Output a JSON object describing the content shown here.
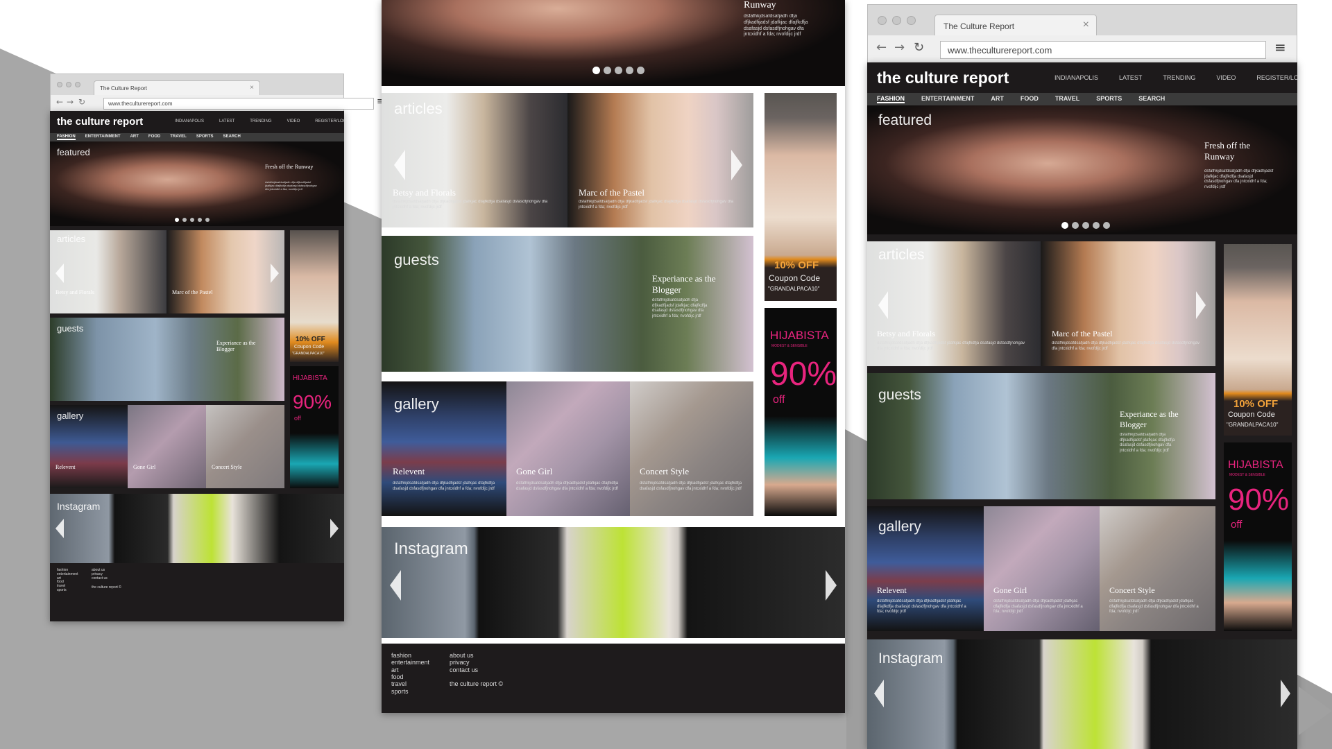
{
  "browser": {
    "tab_title": "The Culture Report",
    "tab_close": "×",
    "url": "www.theculturereport.com",
    "back": "←",
    "forward": "→",
    "reload": "↻",
    "menu": "≡"
  },
  "site": {
    "brand": "the culture report",
    "top_nav": [
      "INDIANAPOLIS",
      "LATEST",
      "TRENDING",
      "VIDEO",
      "REGISTER/LOGIN"
    ],
    "categories": [
      "FASHION",
      "ENTERTAINMENT",
      "ART",
      "FOOD",
      "TRAVEL",
      "SPORTS",
      "SEARCH"
    ]
  },
  "featured": {
    "label": "featured",
    "caption_title": "Fresh off the Runway",
    "caption_title_short": "Runway",
    "caption_body": "dsfafhkjdsafdsafjadh dfja dfjkadfijadsf jdafkjac dfajfkdfja dsafasjd dsfasdfjnohgav dfa jntcxidhf a fda; nvofdijc jrdf"
  },
  "articles": {
    "label": "articles",
    "items": [
      {
        "title": "Betsy and Florals",
        "body": "dsfafhkjdsafdsafjadh dfja dfjkadfijadsf jdafkjac dfajfkdfja dsafasjd dsfasdfjnohgav dfa jntcxidhf a fda; nvofdijc jrdf"
      },
      {
        "title": "Marc of the Pastel",
        "body": "dsfafhkjdsafdsafjadh dfja dfjkadfijadsf jdafkjac dfajfkdfja dsafasjd dsfasdfjnohgav dfa jntcxidhf a fda; nvofdijc jrdf"
      }
    ]
  },
  "guests": {
    "label": "guests",
    "title": "Experiance as the Blogger",
    "body": "dsfafhkjdsafdsafjadh dfja dfjkadfijadsf jdafkjac dfajfkdfja dsafasjd dsfasdfjnohgav dfa jntcxidhf a fda; nvofdijc jrdf"
  },
  "gallery": {
    "label": "gallery",
    "items": [
      {
        "title": "Relevent",
        "body": "dsfafhkjdsafdsafjadh dfja dfjkadfijadsf jdafkjac dfajfkdfja dsafasjd dsfasdfjnohgav dfa jntcxidhf a fda; nvofdijc jrdf"
      },
      {
        "title": "Gone Girl",
        "body": "dsfafhkjdsafdsafjadh dfja dfjkadfijadsf jdafkjac dfajfkdfja dsafasjd dsfasdfjnohgav dfa jntcxidhf a fda; nvofdijc jrdf"
      },
      {
        "title": "Concert Style",
        "body": "dsfafhkjdsafdsafjadh dfja dfjkadfijadsf jdafkjac dfajfkdfja dsafasjd dsfasdfjnohgav dfa jntcxidhf a fda; nvofdijc jrdf"
      }
    ]
  },
  "instagram": {
    "label": "Instagram"
  },
  "ads": {
    "coupon_line1": "10% OFF",
    "coupon_line2": "Coupon Code",
    "coupon_code": "\"GRANDALPACA10\"",
    "hijab_brand": "HIJABISTA",
    "hijab_tag": "MODEST & SENSIBLE",
    "hijab_pct": "90%",
    "hijab_off": "off"
  },
  "footer": {
    "col1": [
      "fashion",
      "entertainment",
      "art",
      "food",
      "travel",
      "sports"
    ],
    "col2": [
      "about us",
      "privacy",
      "contact us"
    ],
    "copyright": "the culture report ©"
  },
  "colors": {
    "page_dark": "#1f1c1d",
    "accent_pink": "#e8247e",
    "coupon_orange": "#e08a1e",
    "bg_grey": "#a9a9a9"
  }
}
